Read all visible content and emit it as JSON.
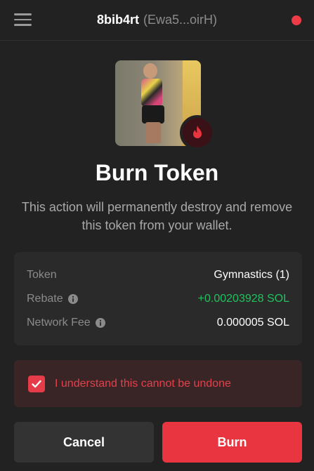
{
  "header": {
    "wallet_name": "8bib4rt",
    "wallet_address": "(Ewa5...oirH)",
    "menu_icon": "hamburger-menu-icon",
    "status_color": "#ef3b47"
  },
  "token_image": {
    "badge_icon": "fire-icon"
  },
  "title": "Burn Token",
  "description": "This action will permanently destroy and remove this token from your wallet.",
  "details": {
    "token": {
      "label": "Token",
      "value": "Gymnastics (1)"
    },
    "rebate": {
      "label": "Rebate",
      "value": "+0.00203928 SOL",
      "icon": "info-icon"
    },
    "network_fee": {
      "label": "Network Fee",
      "value": "0.000005 SOL",
      "icon": "info-icon"
    }
  },
  "confirm": {
    "checked": true,
    "label": "I understand this cannot be undone"
  },
  "buttons": {
    "cancel": "Cancel",
    "burn": "Burn"
  },
  "colors": {
    "accent": "#e8353f",
    "positive": "#21c15e",
    "background": "#222222"
  }
}
